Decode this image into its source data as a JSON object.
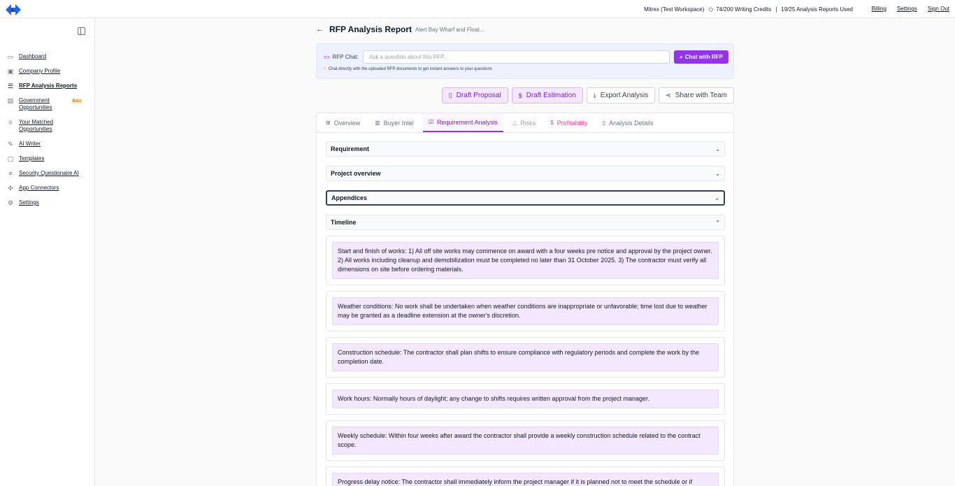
{
  "topbar": {
    "workspace": "Mitrex (Test Workspace)",
    "writing_credits": "74/200 Writing Credits",
    "separator": "|",
    "reports_used": "19/25 Analysis Reports Used",
    "links": {
      "billing": "Billing",
      "settings": "Settings",
      "signout": "Sign Out"
    }
  },
  "sidebar": {
    "items": [
      {
        "label": "Dashboard",
        "icon": "chat-icon"
      },
      {
        "label": "Company Profile",
        "icon": "folder-icon"
      },
      {
        "label": "RFP Analysis Reports",
        "icon": "list-icon"
      },
      {
        "label": "Government Opportunities",
        "icon": "database-icon",
        "badge": "Beta"
      },
      {
        "label": "Your Matched Opportunities",
        "icon": "trophy-icon"
      },
      {
        "label": "AI Writer",
        "icon": "pencil-icon"
      },
      {
        "label": "Templates",
        "icon": "template-icon"
      },
      {
        "label": "Security Questionaire AI",
        "icon": "shield-list-icon"
      },
      {
        "label": "App Connectors",
        "icon": "puzzle-icon"
      },
      {
        "label": "Settings",
        "icon": "gear-icon"
      }
    ]
  },
  "header": {
    "title": "RFP Analysis Report",
    "subtitle": "Alert Bay Wharf and Float..."
  },
  "chat": {
    "label": "RFP Chat:",
    "placeholder": "Ask a question about this RFP...",
    "button": "Chat with RFP",
    "hint": "Chat directly with the uploaded RFP documents to get instant answers to your questions"
  },
  "actions": {
    "draft_proposal": "Draft Proposal",
    "draft_estimation": "Draft Estimation",
    "export_analysis": "Export Analysis",
    "share": "Share with Team"
  },
  "tabs": {
    "overview": "Overview",
    "buyer_intel": "Buyer Intel",
    "requirement_analysis": "Requirement Analysis",
    "risks": "Risks",
    "profitability": "Profitability",
    "analysis_details": "Analysis Details"
  },
  "sections": {
    "requirement": "Requirement",
    "project_overview": "Project overview",
    "appendices": "Appendices",
    "timeline": "Timeline"
  },
  "timeline_items": [
    "Start and finish of works: 1) All off site works may commence on award with a four weeks pre notice and approval by the project owner. 2) All works including cleanup and demobilization must be completed no later than 31 October 2025. 3) The contractor must verify all dimensions on site before ordering materials.",
    "Weather conditions: No work shall be undertaken when weather conditions are inappropriate or unfavorable; time lost due to weather may be granted as a deadline extension at the owner's discretion.",
    "Construction schedule: The contractor shall plan shifts to ensure compliance with regulatory periods and complete the work by the completion date.",
    "Work hours: Normally hours of daylight; any change to shifts requires written approval from the project manager.",
    "Weekly schedule: Within four weeks after award the contractor shall provide a weekly construction schedule related to the contract scope.",
    "Progress delay notice: The contractor shall immediately inform the project manager if it is planned not to meet the schedule or if"
  ]
}
